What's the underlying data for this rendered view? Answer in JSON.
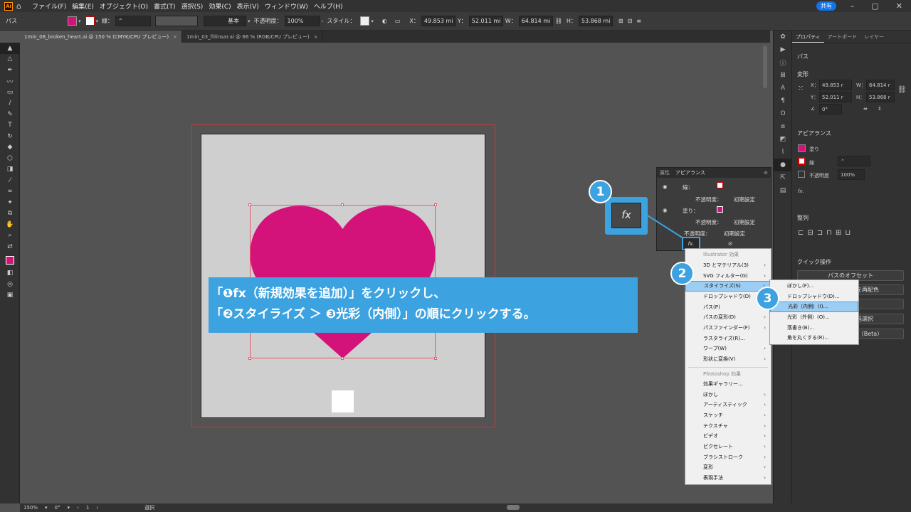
{
  "menubar": {
    "logo": "Ai",
    "items": [
      "ファイル(F)",
      "編集(E)",
      "オブジェクト(O)",
      "書式(T)",
      "選択(S)",
      "効果(C)",
      "表示(V)",
      "ウィンドウ(W)",
      "ヘルプ(H)"
    ],
    "share": "共有"
  },
  "control": {
    "label": "パス",
    "stroke_label": "線：",
    "brush": "基本",
    "opacity_label": "不透明度：",
    "opacity": "100%",
    "style_label": "スタイル：",
    "x_label": "X：",
    "x": "49.853 mi",
    "y_label": "Y：",
    "y": "52.011 mi",
    "w_label": "W：",
    "w": "64.814 mi",
    "h_label": "H：",
    "h": "53.868 mi"
  },
  "tabs": [
    {
      "label": "1min_08_broken_heart.ai @ 150 % (CMYK/CPU プレビュー)",
      "active": true
    },
    {
      "label": "1min_03_fillinsar.ai @ 66 % (RGB/CPU プレビュー)",
      "active": false
    }
  ],
  "colors": {
    "fill": "#d4137a",
    "accent": "#3da2e0",
    "bleed": "#c23b3b"
  },
  "props": {
    "tabs": [
      "プロパティ",
      "アートボード",
      "レイヤー"
    ],
    "object": "パス",
    "transform": "変形",
    "x_label": "X：",
    "x": "49.853 r",
    "y_label": "Y：",
    "y": "52.011 r",
    "w_label": "W：",
    "w": "64.814 r",
    "h_label": "H：",
    "h": "53.868 r",
    "angle": "0°",
    "appearance": "アピアランス",
    "fill": "塗り",
    "stroke": "線",
    "opacity_label": "不透明度",
    "opacity": "100%",
    "fx": "fx.",
    "align": "整列",
    "quick": "クイック操作",
    "offset_btn": "パスのオフセット",
    "recolor_btn": "オブジェクトを再配色",
    "select_btn": "同じ色を一括選択",
    "live_btn": "ライブペイント（Beta）"
  },
  "appearance_panel": {
    "tabs": [
      "属性",
      "アピアランス"
    ],
    "stroke_label": "線：",
    "opacity_label": "不透明度：",
    "default": "初期設定",
    "fill_label": "塗り：",
    "fx": "fx."
  },
  "fx_zoom": "fx",
  "circles": [
    "1",
    "2",
    "3"
  ],
  "menu1": {
    "header1": "Illustrator 効果",
    "items1": [
      "3D とマテリアル(3)",
      "SVG フィルター(G)",
      "スタイライズ(S)",
      "ドロップシャドウ(D)",
      "パス(P)",
      "パスの変形(D)",
      "パスファインダー(F)",
      "ラスタライズ(R)...",
      "ワープ(W)",
      "形状に変換(V)"
    ],
    "header2": "Photoshop 効果",
    "items2": [
      "効果ギャラリー...",
      "ぼかし",
      "アーティスティック",
      "スケッチ",
      "テクスチャ",
      "ビデオ",
      "ピクセレート",
      "ブラシストローク",
      "変形",
      "表現手法"
    ]
  },
  "menu2": {
    "items": [
      "ぼかし(F)...",
      "ドロップシャドウ(D)...",
      "光彩（内側）(I)...",
      "光彩（外側）(O)...",
      "落書き(B)...",
      "角を丸くする(R)..."
    ]
  },
  "callout": {
    "line1": "「❶fx（新規効果を追加）」をクリックし、",
    "line2": "「❷スタイライズ ＞ ❸光彩（内側）」の順にクリックする。"
  },
  "status": {
    "zoom": "150%",
    "angle": "0°",
    "page": "1",
    "mode": "選択"
  }
}
